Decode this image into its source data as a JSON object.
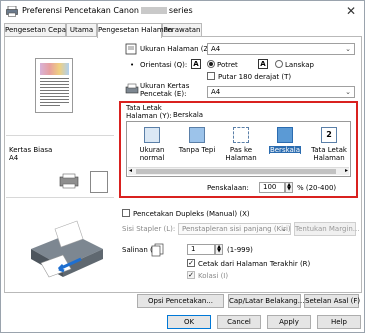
{
  "window": {
    "title_prefix": "Preferensi Pencetakan Canon",
    "title_suffix": "series",
    "close_label": "✕"
  },
  "tabs": [
    {
      "label": "Pengesetan Cepat"
    },
    {
      "label": "Utama"
    },
    {
      "label": "Pengesetan Halaman"
    },
    {
      "label": "Perawatan"
    }
  ],
  "left": {
    "media": "Kertas Biasa",
    "size": "A4"
  },
  "page_size": {
    "label": "Ukuran Halaman (Z):",
    "value": "A4"
  },
  "orientation": {
    "label": "Orientasi (Q):",
    "portrait": "Potret",
    "landscape": "Lanskap",
    "rotate_label": "Putar 180 derajat (T)"
  },
  "printer_paper": {
    "label_line1": "Ukuran Kertas",
    "label_line2": "Pencetak (E):",
    "value": "A4"
  },
  "layout": {
    "label_line1": "Tata Letak",
    "label_line2": "Halaman (Y):",
    "current": "Berskala",
    "items": [
      {
        "line1": "Ukuran normal",
        "line2": ""
      },
      {
        "line1": "Tanpa Tepi",
        "line2": ""
      },
      {
        "line1": "Pas ke",
        "line2": "Halaman"
      },
      {
        "line1": "Berskala",
        "line2": ""
      },
      {
        "line1": "Tata Letak",
        "line2": "Halaman"
      }
    ],
    "scale_label": "Penskalaan:",
    "scale_value": "100",
    "scale_range": "% (20-400)"
  },
  "duplex": {
    "label": "Pencetakan Dupleks (Manual) (X)",
    "stapling_label": "Sisi Stapler (L):",
    "stapling_value": "Penstapleran sisi panjang (Kiri)",
    "margin_button": "Tentukan Margin..."
  },
  "copies": {
    "label": "Salinan (C):",
    "value": "1",
    "range": "(1-999)",
    "reverse_label": "Cetak dari Halaman Terakhir (R)",
    "collate_label": "Kolasi (I)"
  },
  "buttons": {
    "print_options": "Opsi Pencetakan...",
    "stamp": "Cap/Latar Belakang...",
    "defaults": "Setelan Asal (F)",
    "ok": "OK",
    "cancel": "Cancel",
    "apply": "Apply",
    "help": "Help"
  }
}
